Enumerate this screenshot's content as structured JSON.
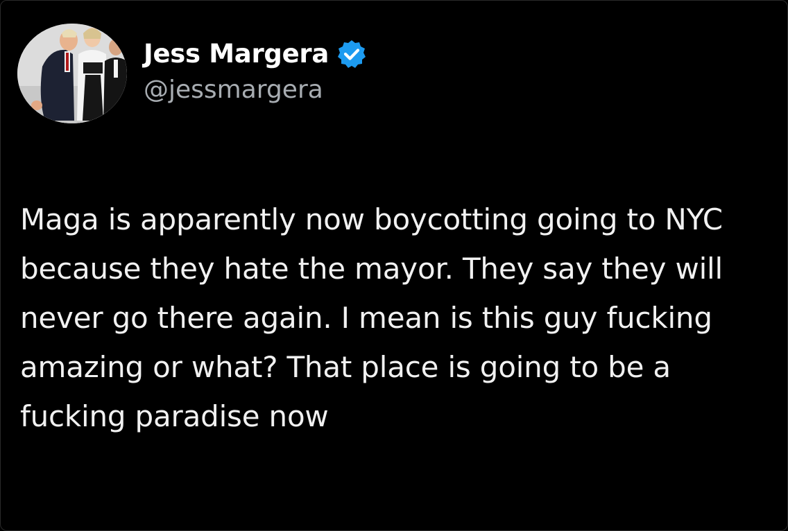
{
  "tweet": {
    "author": {
      "display_name": "Jess Margera",
      "handle": "@jessmargera",
      "verified": true,
      "verified_badge_color": "#1d9bf0",
      "avatar": "profile-photo"
    },
    "text": "Maga is apparently now boycotting going to NYC because they hate the mayor. They say they will never go there again. I mean is this guy fucking amazing or what? That place is going to be a fucking paradise now"
  },
  "colors": {
    "background": "#000000",
    "text": "#f1f1f1",
    "handle": "#a8adb2"
  }
}
